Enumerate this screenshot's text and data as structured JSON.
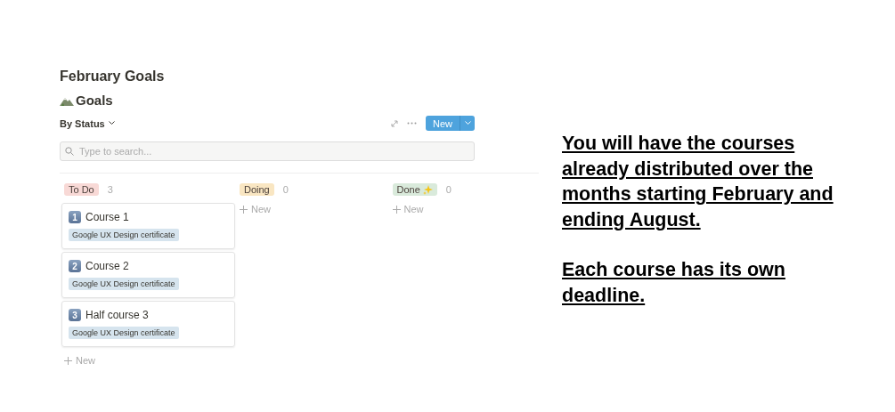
{
  "page_title": "February Goals",
  "database": {
    "title": "Goals",
    "view": "By Status",
    "new_button": "New",
    "search": {
      "placeholder": "Type to search..."
    }
  },
  "columns": [
    {
      "label": "To Do",
      "color": "#f8d9d6",
      "count": "3",
      "sparkle": false,
      "cards": [
        {
          "number": "1",
          "title": "Course 1",
          "tag": "Google UX Design certificate"
        },
        {
          "number": "2",
          "title": "Course 2",
          "tag": "Google UX Design certificate"
        },
        {
          "number": "3",
          "title": "Half course 3",
          "tag": "Google UX Design certificate"
        }
      ],
      "add": "New"
    },
    {
      "label": "Doing",
      "color": "#f9e6c2",
      "count": "0",
      "sparkle": false,
      "add": "New"
    },
    {
      "label": "Done",
      "color": "#d9eadb",
      "count": "0",
      "sparkle": true,
      "add": "New"
    }
  ],
  "note": {
    "paragraphs": [
      "You will have the courses already distributed over the months starting February and ending August.",
      "Each course has its own deadline."
    ]
  }
}
